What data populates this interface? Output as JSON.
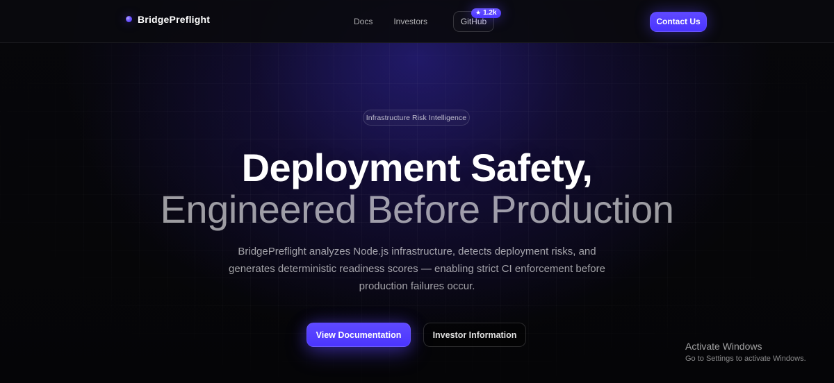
{
  "nav": {
    "brand": "BridgePreflight",
    "links": [
      {
        "label": "Docs"
      },
      {
        "label": "Investors"
      }
    ],
    "github": {
      "label": "GitHub",
      "stars": "1.2k"
    },
    "contact_label": "Contact Us"
  },
  "hero": {
    "pill_label": "Infrastructure Risk Intelligence",
    "headline_1": "Deployment Safety,",
    "headline_2": "Engineered Before Production",
    "subhead_lines": [
      "BridgePreflight analyzes Node.js infrastructure, detects deployment risks, and",
      "generates deterministic readiness scores — enabling strict CI enforcement before",
      "production failures occur."
    ],
    "primary_cta": "View Documentation",
    "secondary_cta": "Investor Information"
  },
  "os_watermark": {
    "title": "Activate Windows",
    "subtitle": "Go to Settings to activate Windows."
  },
  "colors": {
    "accent": "#5b44ff",
    "background": "#050507"
  },
  "icons": {
    "brand": "dot-icon",
    "star": "star-icon"
  }
}
